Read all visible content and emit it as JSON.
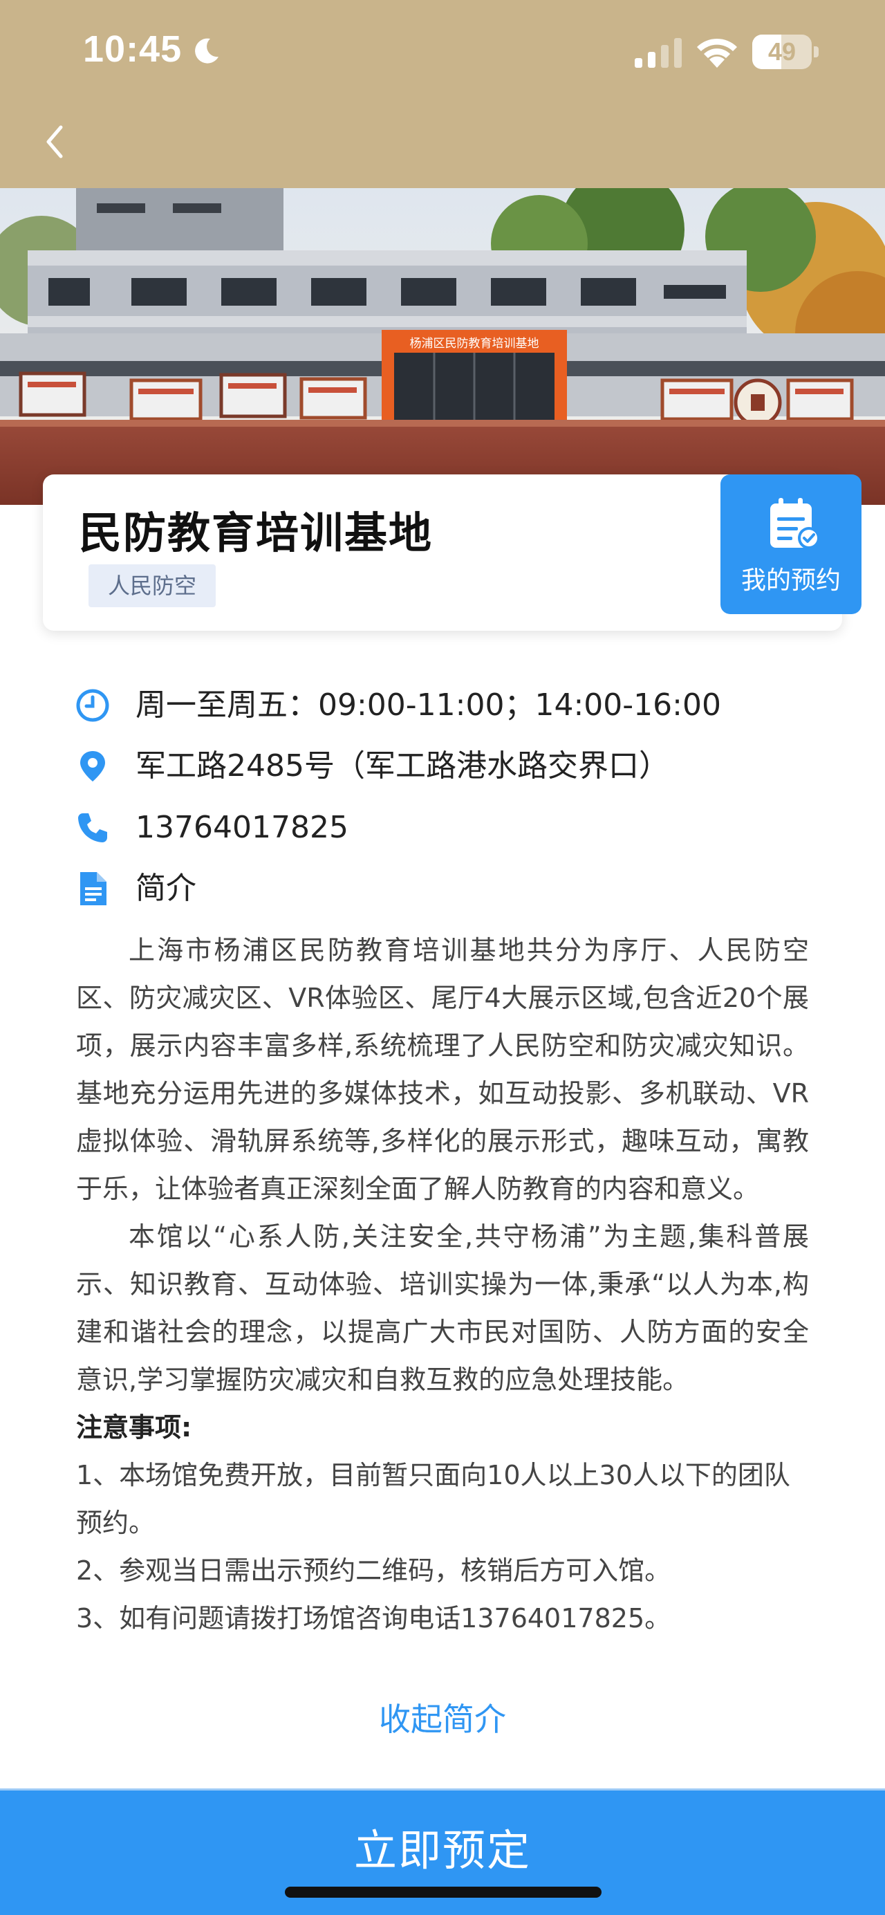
{
  "status_bar": {
    "time": "10:45",
    "battery": "49",
    "battery_level": 0.49
  },
  "header": {
    "back_icon": "chevron-left-icon"
  },
  "hero": {
    "sign_text": "杨浦区民防教育培训基地"
  },
  "venue": {
    "title": "民防教育培训基地",
    "tag": "人民防空",
    "booking_label": "我的预约"
  },
  "details": {
    "hours": "周一至周五：09:00-11:00；14:00-16:00",
    "address": "军工路2485号（军工路港水路交界口）",
    "phone": "13764017825",
    "intro_label": "简介"
  },
  "intro": {
    "paragraph_1": "上海市杨浦区民防教育培训基地共分为序厅、人民防空区、防灾减灾区、VR体验区、尾厅4大展示区域,包含近20个展项，展示内容丰富多样,系统梳理了人民防空和防灾减灾知识。基地充分运用先进的多媒体技术，如互动投影、多机联动、VR虚拟体验、滑轨屏系统等,多样化的展示形式，趣味互动，寓教于乐，让体验者真正深刻全面了解人防教育的内容和意义。",
    "paragraph_2": "本馆以“心系人防,关注安全,共守杨浦”为主题,集科普展示、知识教育、互动体验、培训实操为一体,秉承“以人为本,构建和谐社会的理念，以提高广大市民对国防、人防方面的安全意识,学习掌握防灾减灾和自救互救的应急处理技能。",
    "notes_title": "注意事项:",
    "notes": [
      "1、本场馆免费开放，目前暂只面向10人以上30人以下的团队预约。",
      "2、参观当日需出示预约二维码，核销后方可入馆。",
      "3、如有问题请拨打场馆咨询电话13764017825。"
    ],
    "collapse_label": "收起简介"
  },
  "footer": {
    "reserve_label": "立即预定"
  },
  "colors": {
    "header": "#c9b48b",
    "accent": "#2f96f3",
    "tag_bg": "#e7edf8"
  }
}
